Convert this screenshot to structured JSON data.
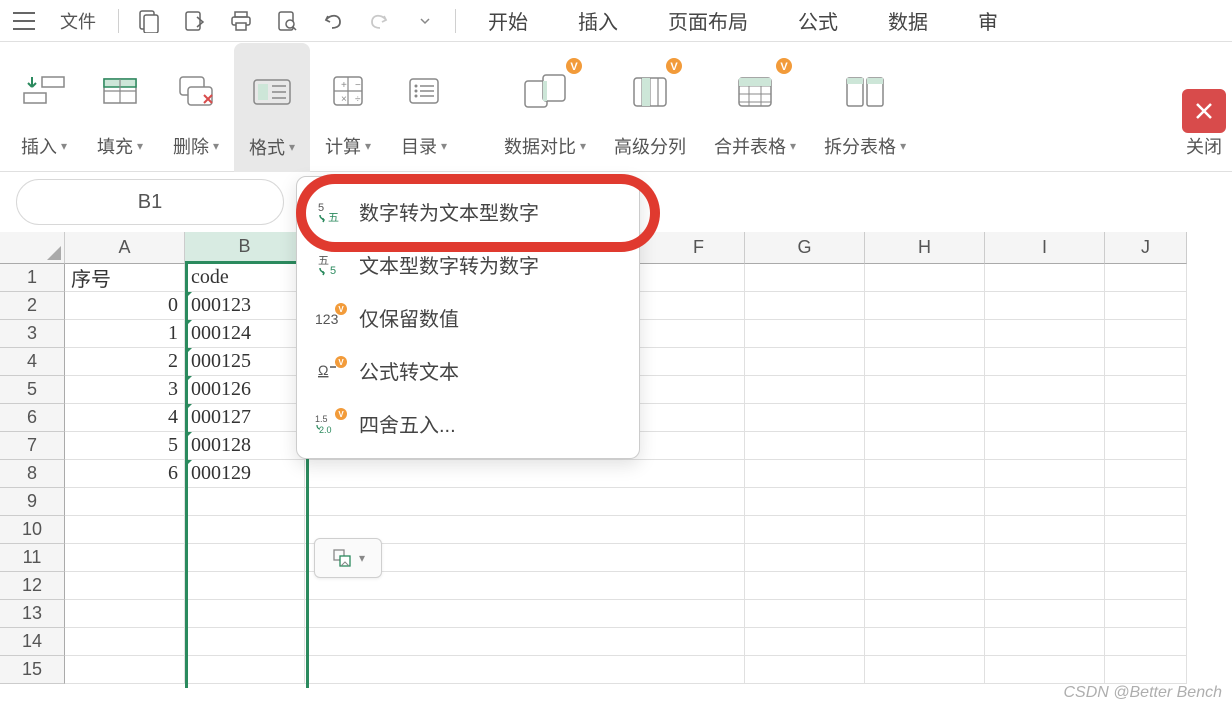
{
  "menubar": {
    "file": "文件",
    "tabs": [
      "开始",
      "插入",
      "页面布局",
      "公式",
      "数据",
      "审"
    ]
  },
  "ribbon": {
    "insert": "插入",
    "fill": "填充",
    "delete": "删除",
    "format": "格式",
    "calc": "计算",
    "toc": "目录",
    "datacompare": "数据对比",
    "advsplit": "高级分列",
    "mergetable": "合并表格",
    "splittable": "拆分表格",
    "close": "关闭"
  },
  "namebox": "B1",
  "columns": [
    "A",
    "B",
    "F",
    "G",
    "H",
    "I",
    "J"
  ],
  "rows": [
    {
      "n": "1",
      "a": "序号",
      "b": "code"
    },
    {
      "n": "2",
      "a": "0",
      "b": "000123"
    },
    {
      "n": "3",
      "a": "1",
      "b": "000124"
    },
    {
      "n": "4",
      "a": "2",
      "b": "000125"
    },
    {
      "n": "5",
      "a": "3",
      "b": "000126"
    },
    {
      "n": "6",
      "a": "4",
      "b": "000127"
    },
    {
      "n": "7",
      "a": "5",
      "b": "000128"
    },
    {
      "n": "8",
      "a": "6",
      "b": "000129"
    },
    {
      "n": "9",
      "a": "",
      "b": ""
    },
    {
      "n": "10",
      "a": "",
      "b": ""
    },
    {
      "n": "11",
      "a": "",
      "b": ""
    },
    {
      "n": "12",
      "a": "",
      "b": ""
    },
    {
      "n": "13",
      "a": "",
      "b": ""
    },
    {
      "n": "14",
      "a": "",
      "b": ""
    },
    {
      "n": "15",
      "a": "",
      "b": ""
    }
  ],
  "dropdown": {
    "item1": "数字转为文本型数字",
    "item2": "文本型数字转为数字",
    "item3": "仅保留数值",
    "item4": "公式转文本",
    "item5": "四舍五入..."
  },
  "watermark": "CSDN @Better Bench"
}
